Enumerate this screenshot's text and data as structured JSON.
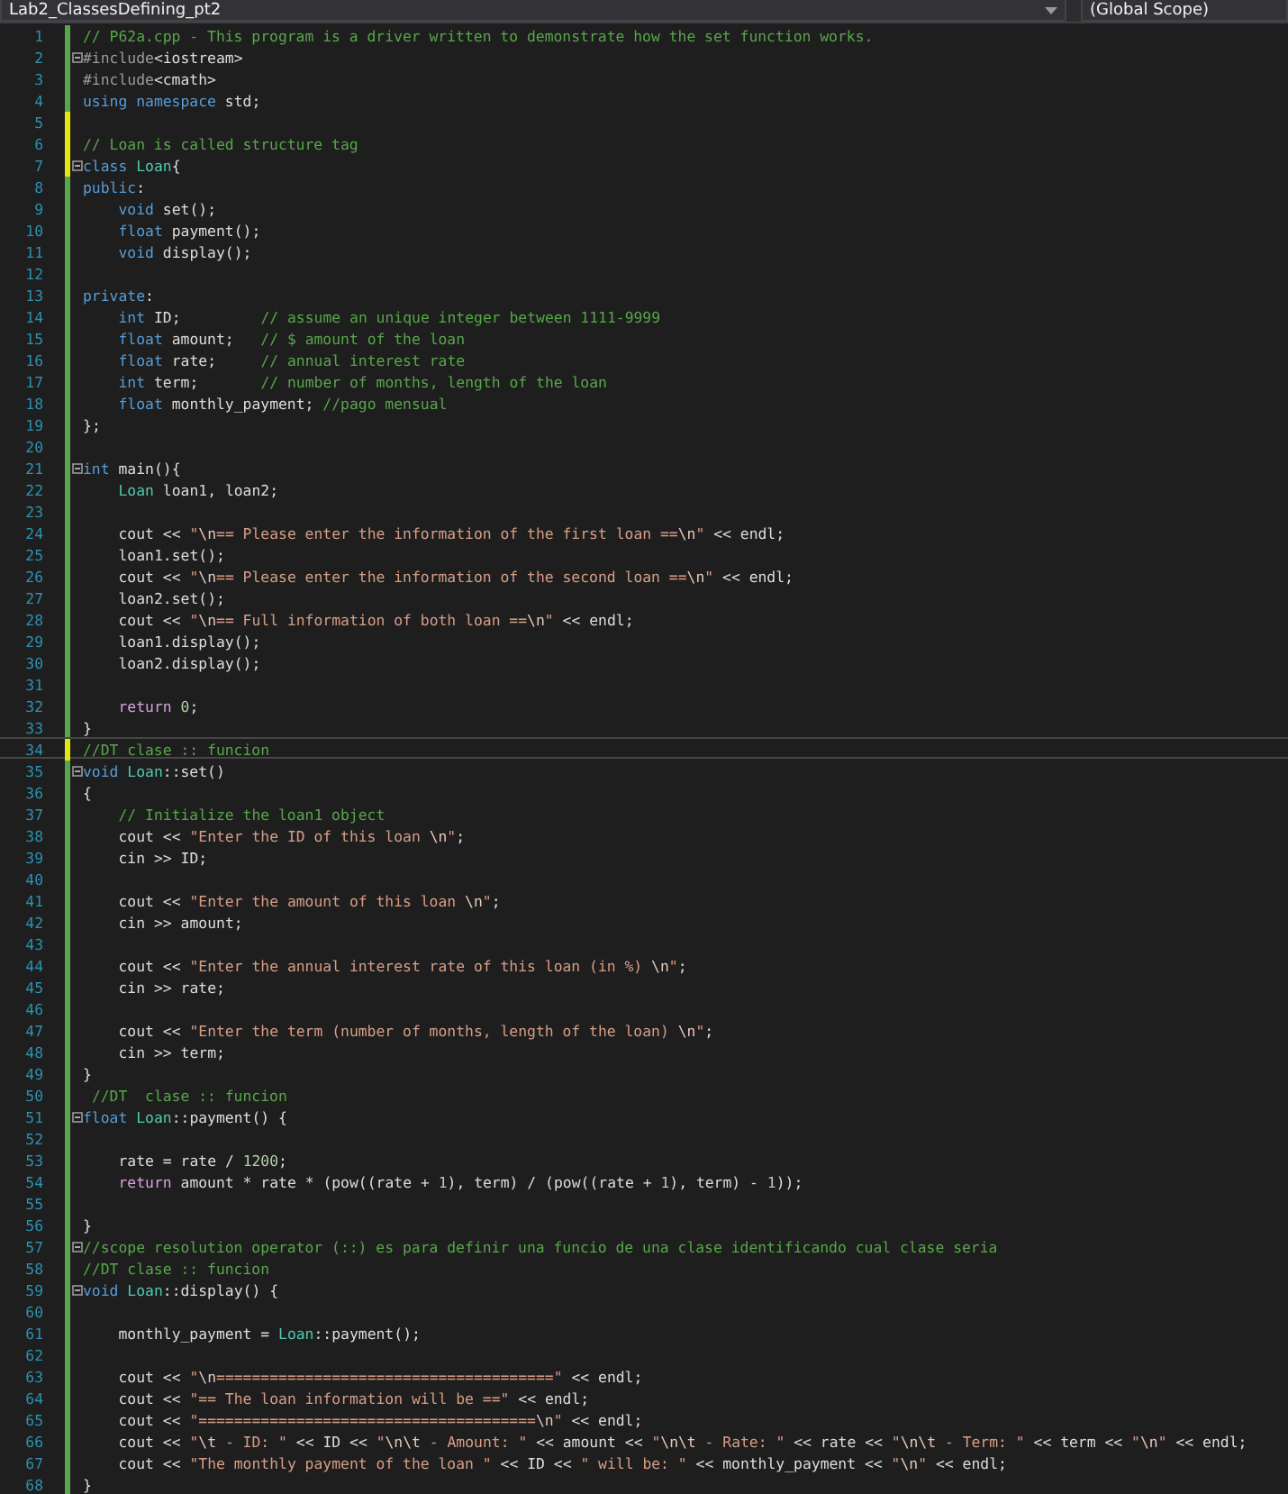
{
  "navigation_bar": {
    "file_dropdown": "Lab2_ClassesDefining_pt2",
    "scope_dropdown": "(Global Scope)"
  },
  "lines": [
    {
      "number": "1",
      "edited": false,
      "text": "// P62a.cpp - This program is a driver written to demonstrate how the set function works."
    },
    {
      "number": "2",
      "edited": false,
      "fold": true,
      "text": "#include<iostream>"
    },
    {
      "number": "3",
      "edited": false,
      "text": "#include<cmath>"
    },
    {
      "number": "4",
      "edited": false,
      "text": "using namespace std;"
    },
    {
      "number": "5",
      "edited": true
    },
    {
      "number": "6",
      "edited": true,
      "text": "// Loan is called structure tag"
    },
    {
      "number": "7",
      "edited": true,
      "fold": true,
      "text": "class Loan{"
    },
    {
      "number": "8",
      "edited": false,
      "text": "public:"
    },
    {
      "number": "9",
      "edited": false,
      "text": "    void set();"
    },
    {
      "number": "10",
      "edited": false,
      "text": "    float payment();"
    },
    {
      "number": "11",
      "edited": false,
      "text": "    void display();"
    },
    {
      "number": "12",
      "edited": false
    },
    {
      "number": "13",
      "edited": false,
      "text": "private:"
    },
    {
      "number": "14",
      "edited": false,
      "text": "    int ID;         // assume an unique integer between 1111-9999"
    },
    {
      "number": "15",
      "edited": false,
      "text": "    float amount;   // $ amount of the loan"
    },
    {
      "number": "16",
      "edited": false,
      "text": "    float rate;     // annual interest rate"
    },
    {
      "number": "17",
      "edited": false,
      "text": "    int term;       // number of months, length of the loan"
    },
    {
      "number": "18",
      "edited": false,
      "text": "    float monthly_payment; //pago mensual"
    },
    {
      "number": "19",
      "edited": false,
      "text": "};"
    },
    {
      "number": "20",
      "edited": false
    },
    {
      "number": "21",
      "edited": false,
      "fold": true,
      "text": "int main(){"
    },
    {
      "number": "22",
      "edited": false,
      "text": "    Loan loan1, loan2;"
    },
    {
      "number": "23",
      "edited": false
    },
    {
      "number": "24",
      "edited": false,
      "text": "    cout << \"\\n== Please enter the information of the first loan ==\\n\" << endl;"
    },
    {
      "number": "25",
      "edited": false,
      "text": "    loan1.set();"
    },
    {
      "number": "26",
      "edited": false,
      "text": "    cout << \"\\n== Please enter the information of the second loan ==\\n\" << endl;"
    },
    {
      "number": "27",
      "edited": false,
      "text": "    loan2.set();"
    },
    {
      "number": "28",
      "edited": false,
      "text": "    cout << \"\\n== Full information of both loan ==\\n\" << endl;"
    },
    {
      "number": "29",
      "edited": false,
      "text": "    loan1.display();"
    },
    {
      "number": "30",
      "edited": false,
      "text": "    loan2.display();"
    },
    {
      "number": "31",
      "edited": false
    },
    {
      "number": "32",
      "edited": false,
      "text": "    return 0;"
    },
    {
      "number": "33",
      "edited": false,
      "text": "}"
    },
    {
      "number": "34",
      "edited": true,
      "current": true,
      "text": "//DT clase :: funcion"
    },
    {
      "number": "35",
      "edited": false,
      "fold": true,
      "text": "void Loan::set()"
    },
    {
      "number": "36",
      "edited": false,
      "text": "{"
    },
    {
      "number": "37",
      "edited": false,
      "text": "    // Initialize the loan1 object"
    },
    {
      "number": "38",
      "edited": false,
      "text": "    cout << \"Enter the ID of this loan \\n\";"
    },
    {
      "number": "39",
      "edited": false,
      "text": "    cin >> ID;"
    },
    {
      "number": "40",
      "edited": false
    },
    {
      "number": "41",
      "edited": false,
      "text": "    cout << \"Enter the amount of this loan \\n\";"
    },
    {
      "number": "42",
      "edited": false,
      "text": "    cin >> amount;"
    },
    {
      "number": "43",
      "edited": false
    },
    {
      "number": "44",
      "edited": false,
      "text": "    cout << \"Enter the annual interest rate of this loan (in %) \\n\";"
    },
    {
      "number": "45",
      "edited": false,
      "text": "    cin >> rate;"
    },
    {
      "number": "46",
      "edited": false
    },
    {
      "number": "47",
      "edited": false,
      "text": "    cout << \"Enter the term (number of months, length of the loan) \\n\";"
    },
    {
      "number": "48",
      "edited": false,
      "text": "    cin >> term;"
    },
    {
      "number": "49",
      "edited": false,
      "text": "}"
    },
    {
      "number": "50",
      "edited": false,
      "text": " //DT  clase :: funcion"
    },
    {
      "number": "51",
      "edited": false,
      "fold": true,
      "text": "float Loan::payment() {"
    },
    {
      "number": "52",
      "edited": false
    },
    {
      "number": "53",
      "edited": false,
      "text": "    rate = rate / 1200;"
    },
    {
      "number": "54",
      "edited": false,
      "text": "    return amount * rate * (pow((rate + 1), term) / (pow((rate + 1), term) - 1));"
    },
    {
      "number": "55",
      "edited": false
    },
    {
      "number": "56",
      "edited": false,
      "text": "}"
    },
    {
      "number": "57",
      "edited": false,
      "fold": true,
      "text": "//scope resolution operator (::) es para definir una funcio de una clase identificando cual clase seria"
    },
    {
      "number": "58",
      "edited": false,
      "text": "//DT clase :: funcion"
    },
    {
      "number": "59",
      "edited": false,
      "fold": true,
      "text": "void Loan::display() {"
    },
    {
      "number": "60",
      "edited": false
    },
    {
      "number": "61",
      "edited": false,
      "text": "    monthly_payment = Loan::payment();"
    },
    {
      "number": "62",
      "edited": false
    },
    {
      "number": "63",
      "edited": false,
      "text": "    cout << \"\\n======================================\" << endl;"
    },
    {
      "number": "64",
      "edited": false,
      "text": "    cout << \"== The loan information will be ==\" << endl;"
    },
    {
      "number": "65",
      "edited": false,
      "text": "    cout << \"======================================\\n\" << endl;"
    },
    {
      "number": "66",
      "edited": false,
      "text": "    cout << \"\\t - ID: \" << ID << \"\\n\\t - Amount: \" << amount << \"\\n\\t - Rate: \" << rate << \"\\n\\t - Term: \" << term << \"\\n\" << endl;"
    },
    {
      "number": "67",
      "edited": false,
      "text": "    cout << \"The monthly payment of the loan \" << ID << \" will be: \" << monthly_payment << \"\\n\" << endl;"
    },
    {
      "number": "68",
      "edited": false,
      "text": "}"
    }
  ]
}
